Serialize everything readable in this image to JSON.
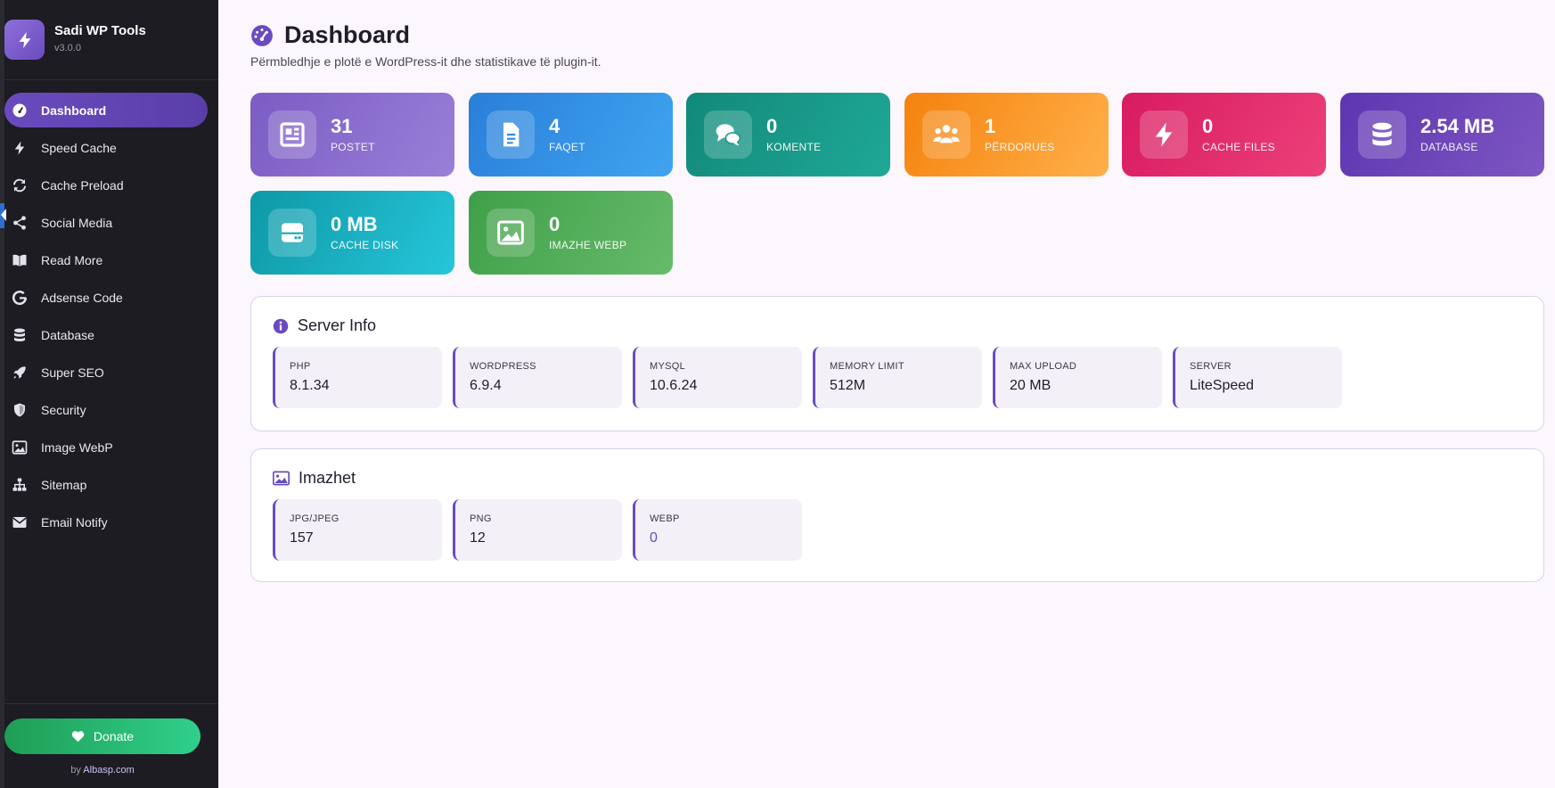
{
  "app": {
    "title": "Sadi WP Tools",
    "version": "v3.0.0"
  },
  "sidebar": {
    "items": [
      {
        "label": "Dashboard",
        "icon": "gauge-icon"
      },
      {
        "label": "Speed Cache",
        "icon": "bolt-icon"
      },
      {
        "label": "Cache Preload",
        "icon": "sync-icon"
      },
      {
        "label": "Social Media",
        "icon": "share-icon"
      },
      {
        "label": "Read More",
        "icon": "book-open-icon"
      },
      {
        "label": "Adsense Code",
        "icon": "google-icon"
      },
      {
        "label": "Database",
        "icon": "database-icon"
      },
      {
        "label": "Super SEO",
        "icon": "rocket-icon"
      },
      {
        "label": "Security",
        "icon": "shield-icon"
      },
      {
        "label": "Image WebP",
        "icon": "image-icon"
      },
      {
        "label": "Sitemap",
        "icon": "sitemap-icon"
      },
      {
        "label": "Email Notify",
        "icon": "envelope-icon"
      }
    ],
    "active_index": 0,
    "donate_label": "Donate",
    "by_prefix": "by",
    "by_link": "Albasp.com"
  },
  "header": {
    "title": "Dashboard",
    "subtitle": "Përmbledhje e plotë e WordPress-it dhe statistikave të plugin-it."
  },
  "stats": [
    {
      "value": "31",
      "label": "POSTET",
      "icon": "newspaper-icon",
      "color_from": "#7b5cc4",
      "color_to": "#9a7fd8"
    },
    {
      "value": "4",
      "label": "FAQET",
      "icon": "file-icon",
      "color_from": "#2a7fd9",
      "color_to": "#3fa4f0"
    },
    {
      "value": "0",
      "label": "KOMENTE",
      "icon": "comments-icon",
      "color_from": "#12897a",
      "color_to": "#1fa896"
    },
    {
      "value": "1",
      "label": "PËRDORUES",
      "icon": "users-icon",
      "color_from": "#f5820d",
      "color_to": "#ffb04a"
    },
    {
      "value": "0",
      "label": "CACHE FILES",
      "icon": "bolt-icon",
      "color_from": "#d81b60",
      "color_to": "#ec407a"
    },
    {
      "value": "2.54 MB",
      "label": "DATABASE",
      "icon": "database-icon",
      "color_from": "#5e35b1",
      "color_to": "#7e57c2"
    },
    {
      "value": "0 MB",
      "label": "CACHE DISK",
      "icon": "hdd-icon",
      "color_from": "#0e98a6",
      "color_to": "#26c6da"
    },
    {
      "value": "0",
      "label": "IMAZHE WEBP",
      "icon": "image-icon",
      "color_from": "#3f9f48",
      "color_to": "#66bb6a"
    }
  ],
  "server_info": {
    "title": "Server Info",
    "items": [
      {
        "label": "PHP",
        "value": "8.1.34"
      },
      {
        "label": "WORDPRESS",
        "value": "6.9.4"
      },
      {
        "label": "MYSQL",
        "value": "10.6.24"
      },
      {
        "label": "MEMORY LIMIT",
        "value": "512M"
      },
      {
        "label": "MAX UPLOAD",
        "value": "20 MB"
      },
      {
        "label": "SERVER",
        "value": "LiteSpeed"
      }
    ]
  },
  "images": {
    "title": "Imazhet",
    "items": [
      {
        "label": "JPG/JPEG",
        "value": "157"
      },
      {
        "label": "PNG",
        "value": "12"
      },
      {
        "label": "WEBP",
        "value": "0",
        "accent": "#6a4bbf"
      }
    ]
  },
  "colors": {
    "accent": "#6a4bbf",
    "sidebar_bg": "#1d1c22",
    "donate": "#2fd08c"
  }
}
